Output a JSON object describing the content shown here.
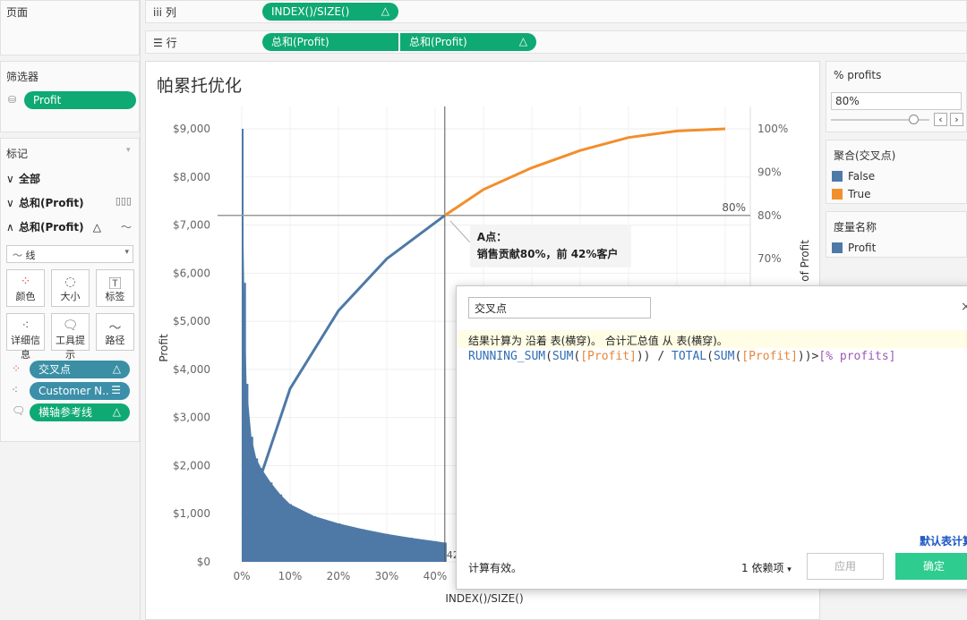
{
  "left": {
    "pages_title": "页面",
    "filters_title": "筛选器",
    "filter_pill": "Profit",
    "marks_title": "标记",
    "marks_rows": [
      "全部",
      "总和(Profit)",
      "总和(Profit)"
    ],
    "mark_type": "线",
    "mark_buttons": [
      "颜色",
      "大小",
      "标签",
      "详细信息",
      "工具提示",
      "路径"
    ],
    "mark_pills": [
      "交叉点",
      "Customer N..",
      "横轴参考线"
    ]
  },
  "shelves": {
    "columns_label": "列",
    "columns_pill": "INDEX()/SIZE()",
    "rows_label": "行",
    "rows_pills": [
      "总和(Profit)",
      "总和(Profit)"
    ]
  },
  "view": {
    "title": "帕累托优化"
  },
  "chart_data": {
    "type": "bar",
    "xlabel": "INDEX()/SIZE()",
    "ylabel": "Profit",
    "y2label": "% of Profit",
    "xlim": [
      0,
      1
    ],
    "ylim": [
      0,
      9000
    ],
    "y2lim": [
      0,
      1
    ],
    "x_ticks": [
      "0%",
      "10%",
      "20%",
      "30%",
      "40%"
    ],
    "y_ticks": [
      "$0",
      "$1,000",
      "$2,000",
      "$3,000",
      "$4,000",
      "$5,000",
      "$6,000",
      "$7,000",
      "$8,000",
      "$9,000"
    ],
    "y2_ticks": [
      "70%",
      "80%",
      "90%",
      "100%"
    ],
    "bar_series": {
      "name": "Profit",
      "color": "#4e79a7",
      "x": [
        0.0,
        0.005,
        0.01,
        0.02,
        0.03,
        0.04,
        0.06,
        0.08,
        0.1,
        0.15,
        0.2,
        0.25,
        0.3,
        0.35,
        0.4,
        0.42
      ],
      "values": [
        9000,
        5800,
        3700,
        2600,
        2150,
        1950,
        1650,
        1400,
        1200,
        950,
        800,
        680,
        580,
        500,
        430,
        400
      ]
    },
    "line_series": [
      {
        "name": "False",
        "color": "#4e79a7",
        "x": [
          0.04,
          0.1,
          0.2,
          0.3,
          0.42
        ],
        "values": [
          0.2,
          0.4,
          0.58,
          0.7,
          0.8
        ]
      },
      {
        "name": "True",
        "color": "#f28e2b",
        "x": [
          0.42,
          0.5,
          0.6,
          0.7,
          0.8,
          0.9,
          1.0
        ],
        "values": [
          0.8,
          0.86,
          0.91,
          0.95,
          0.98,
          0.995,
          1.0
        ]
      }
    ],
    "reference_line": {
      "label": "80%",
      "value": 0.8
    },
    "crosshair_x_label": "42",
    "annotation": {
      "title": "A点：",
      "text": "销售贡献80%，前 42%客户"
    }
  },
  "right": {
    "param_title": "% profits",
    "param_value": "80%",
    "color_legend_title": "聚合(交叉点)",
    "color_legend": [
      {
        "label": "False",
        "color": "#4e79a7"
      },
      {
        "label": "True",
        "color": "#f28e2b"
      }
    ],
    "measure_title": "度量名称",
    "measure_legend": [
      {
        "label": "Profit",
        "color": "#4e79a7"
      }
    ]
  },
  "dialog": {
    "name": "交叉点",
    "hint": "结果计算为 沿着 表(横穿)。 合计汇总值 从 表(横穿)。",
    "formula": {
      "f1": "RUNNING_SUM",
      "f2": "SUM",
      "field1": "[Profit]",
      "op": ")) / ",
      "f3": "TOTAL",
      "f4": "SUM",
      "field2": "[Profit]",
      "end": "))>",
      "param": "[% profits]"
    },
    "status": "计算有效。",
    "deps": "1 依赖项",
    "default_link": "默认表计算",
    "apply": "应用",
    "ok": "确定"
  }
}
